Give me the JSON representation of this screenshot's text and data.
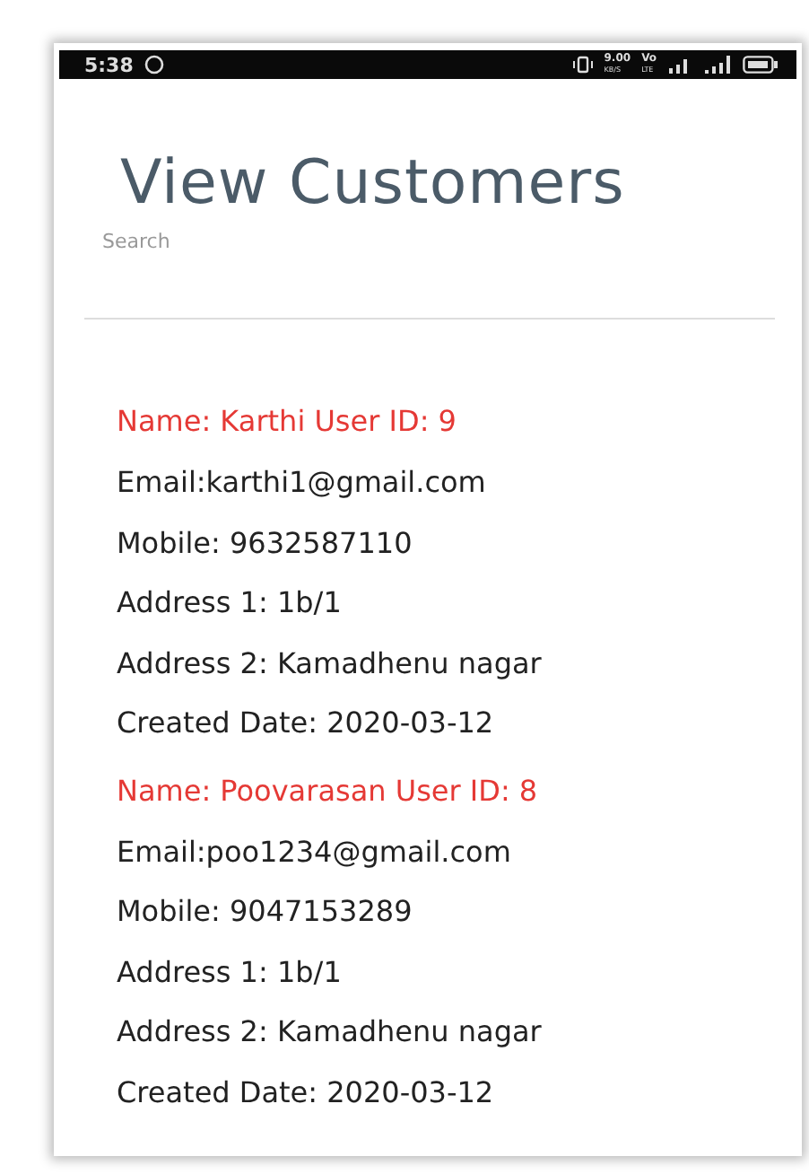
{
  "status_bar": {
    "time": "5:38",
    "speed": "9.00",
    "speed_unit": "KB/S",
    "network": [
      "Vo",
      "LTE"
    ]
  },
  "title": "View Customers",
  "search": {
    "placeholder": "Search"
  },
  "customers": [
    {
      "heading": "Name: Karthi User ID: 9",
      "lines": [
        "Email:karthi1@gmail.com",
        "Mobile: 9632587110",
        "Address 1: 1b/1",
        "Address 2: Kamadhenu nagar",
        "Created Date: 2020-03-12"
      ]
    },
    {
      "heading": "Name: Poovarasan User ID: 8",
      "lines": [
        "Email:poo1234@gmail.com",
        "Mobile: 9047153289",
        "Address 1: 1b/1",
        "Address 2: Kamadhenu nagar",
        "Created Date: 2020-03-12"
      ]
    }
  ]
}
